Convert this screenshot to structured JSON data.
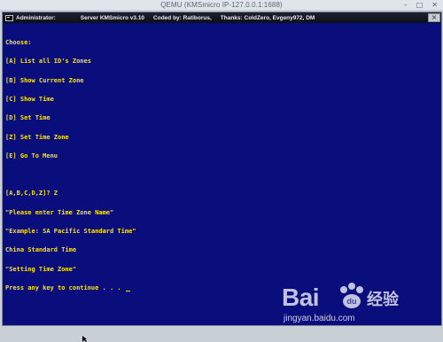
{
  "qemu": {
    "title": "QEMU (KMSmicro IP-127.0.0.1:1688)",
    "minimize_icon": "minimize-icon",
    "maximize_icon": "maximize-icon",
    "close_icon": "close-icon"
  },
  "cmd_window": {
    "title_segments": [
      "Administrator:",
      "Server KMSmicro v3.10",
      "Coded by: Ratiborus,",
      "Thanks: ColdZero, Evgeny972, DM"
    ],
    "close_label": "×"
  },
  "console": {
    "lines": [
      "Choose:",
      "[A] List all ID's Zones",
      "[B] Show Current Zone",
      "[C] Show Time",
      "[D] Set Time",
      "[Z] Set Time Zone",
      "[E] Go To Menu",
      "",
      "[A,B,C,D,Z]? Z",
      "\"Please enter Time Zone Name\"",
      "\"Example: SA Pacific Standard Time\"",
      "China Standard Time",
      "\"Setting Time Zone\"",
      "Press any key to continue . . . "
    ]
  },
  "watermark": {
    "logo": "Bai",
    "chinese": "经验",
    "url": "jingyan.baidu.com"
  },
  "colors": {
    "console_bg": "#0a0d7c",
    "console_text": "#ffe400"
  }
}
